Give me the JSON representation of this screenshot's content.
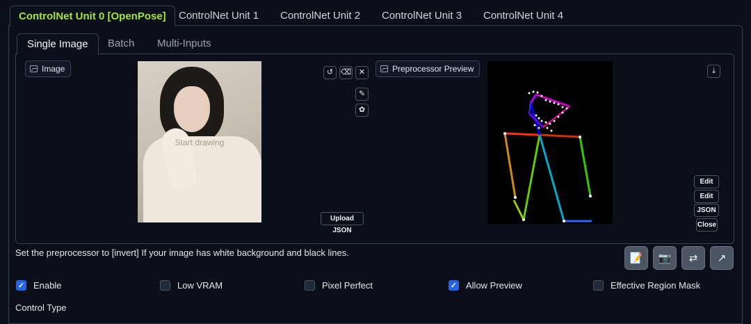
{
  "unit_tabs": [
    {
      "label": "ControlNet Unit 0 [OpenPose]",
      "active": true
    },
    {
      "label": "ControlNet Unit 1",
      "active": false
    },
    {
      "label": "ControlNet Unit 2",
      "active": false
    },
    {
      "label": "ControlNet Unit 3",
      "active": false
    },
    {
      "label": "ControlNet Unit 4",
      "active": false
    }
  ],
  "input_tabs": [
    {
      "label": "Single Image",
      "active": true
    },
    {
      "label": "Batch",
      "active": false
    },
    {
      "label": "Multi-Inputs",
      "active": false
    }
  ],
  "image_panel": {
    "label": "Image",
    "overlay_text": "Start drawing",
    "tool_icons": [
      "undo-icon",
      "eraser-icon",
      "close-icon",
      "brush-icon",
      "palette-icon"
    ],
    "upload_json_label": "Upload JSON"
  },
  "preview_panel": {
    "label": "Preprocessor Preview",
    "download_icon": "download-icon",
    "buttons": {
      "edit_ext": "Edit",
      "edit": "Edit",
      "json": "JSON",
      "close": "Close"
    }
  },
  "hint_text": "Set the preprocessor to [invert] If your image has white background and black lines.",
  "tool_buttons": [
    {
      "icon": "notepad-icon",
      "glyph": "📝"
    },
    {
      "icon": "camera-icon",
      "glyph": "📷"
    },
    {
      "icon": "swap-icon",
      "glyph": "⇄"
    },
    {
      "icon": "send-icon",
      "glyph": "↗"
    }
  ],
  "options": [
    {
      "label": "Enable",
      "checked": true
    },
    {
      "label": "Low VRAM",
      "checked": false
    },
    {
      "label": "Pixel Perfect",
      "checked": false
    },
    {
      "label": "Allow Preview",
      "checked": true
    },
    {
      "label": "Effective Region Mask",
      "checked": false
    }
  ],
  "control_type_label": "Control Type",
  "colors": {
    "accent_active_tab": "#a3e635",
    "checkbox_on": "#2563eb",
    "background": "#0b0f19",
    "border": "#374151"
  }
}
